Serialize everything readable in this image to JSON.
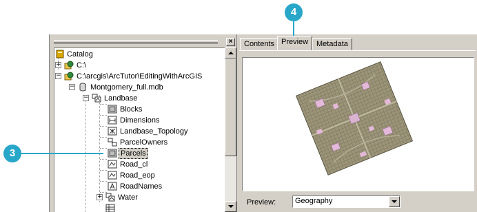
{
  "catalog": {
    "close_glyph": "×",
    "expander_plus": "+",
    "expander_minus": "−",
    "items": [
      {
        "label": "Catalog",
        "icon": "catalog-icon"
      },
      {
        "label": "C:\\",
        "icon": "folder-connection-icon"
      },
      {
        "label": "C:\\arcgis\\ArcTutor\\EditingWithArcGIS",
        "icon": "folder-connection-icon"
      },
      {
        "label": "Montgomery_full.mdb",
        "icon": "geodatabase-icon"
      },
      {
        "label": "Landbase",
        "icon": "feature-dataset-icon"
      },
      {
        "label": "Blocks",
        "icon": "polygon-feature-class-icon"
      },
      {
        "label": "Dimensions",
        "icon": "dimension-feature-class-icon"
      },
      {
        "label": "Landbase_Topology",
        "icon": "topology-icon"
      },
      {
        "label": "ParcelOwners",
        "icon": "relationship-class-icon"
      },
      {
        "label": "Parcels",
        "icon": "polygon-feature-class-icon",
        "selected": true
      },
      {
        "label": "Road_cl",
        "icon": "line-feature-class-icon"
      },
      {
        "label": "Road_eop",
        "icon": "line-feature-class-icon"
      },
      {
        "label": "RoadNames",
        "icon": "annotation-feature-class-icon"
      },
      {
        "label": "Water",
        "icon": "feature-dataset-icon"
      }
    ]
  },
  "tabs": [
    {
      "label": "Contents"
    },
    {
      "label": "Preview",
      "active": true
    },
    {
      "label": "Metadata"
    }
  ],
  "preview": {
    "label": "Preview:",
    "value": "Geography"
  },
  "callouts": {
    "step3": "3",
    "step4": "4"
  },
  "colors": {
    "callout": "#28a7c9",
    "parcel_fill": "#9d9679",
    "parcel_highlight": "#e3b8d8"
  }
}
